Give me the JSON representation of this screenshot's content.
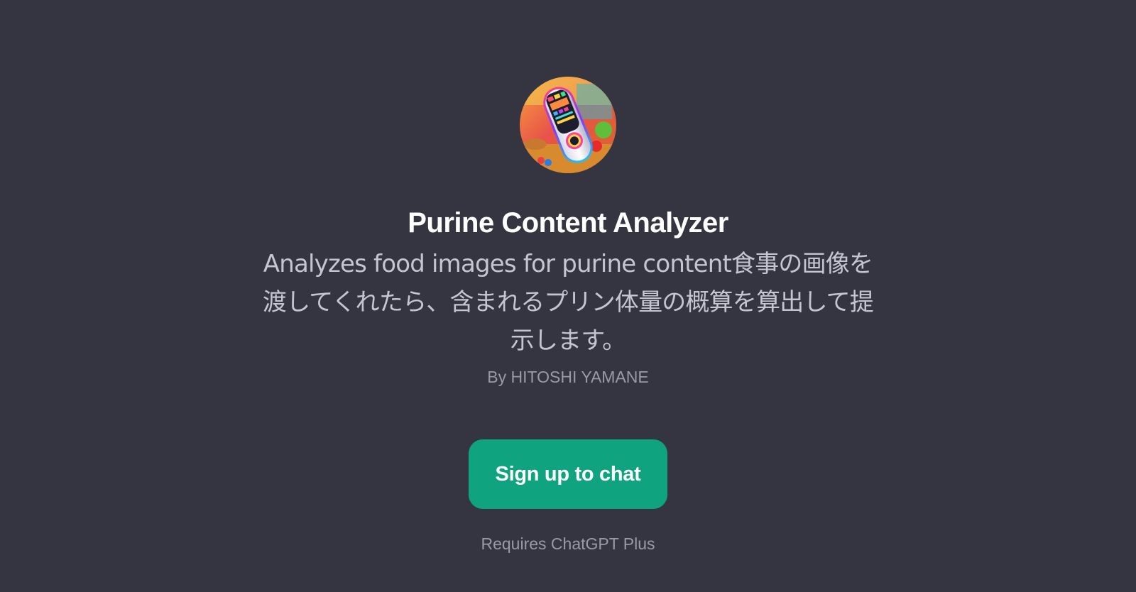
{
  "gpt": {
    "avatar_icon": "purine-analyzer-device-image",
    "title": "Purine Content Analyzer",
    "description": "Analyzes food images for purine content食事の画像を渡してくれたら、含まれるプリン体量の概算を算出して提示します。",
    "author": "By HITOSHI YAMANE"
  },
  "actions": {
    "signup_label": "Sign up to chat",
    "requirement_note": "Requires ChatGPT Plus"
  },
  "colors": {
    "background": "#343541",
    "accent": "#10a37f",
    "title": "#ffffff",
    "description": "#c5c5d2",
    "muted": "#9a9aa6"
  }
}
